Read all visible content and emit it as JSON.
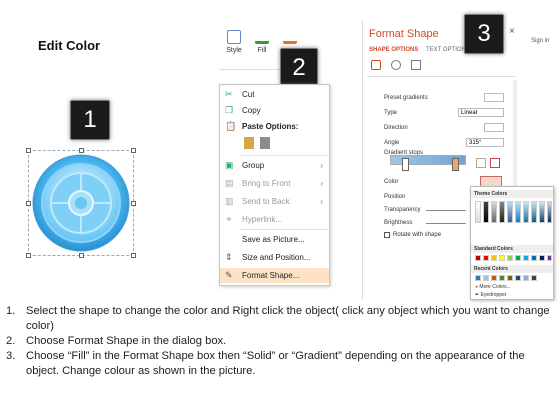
{
  "slide": {
    "title": "Edit Color"
  },
  "badges": [
    "1",
    "2",
    "3"
  ],
  "ribbon": {
    "style_label": "Style",
    "fill_label": "Fill"
  },
  "context_menu": {
    "items": [
      {
        "label": "Cut",
        "icon": "scissors-icon",
        "disabled": false
      },
      {
        "label": "Copy",
        "icon": "copy-icon",
        "disabled": false
      },
      {
        "label": "Paste Options:",
        "icon": "clipboard-icon",
        "disabled": false
      },
      {
        "label": "Group",
        "icon": "group-icon",
        "disabled": false,
        "submenu": true
      },
      {
        "label": "Bring to Front",
        "icon": "bring-to-front-icon",
        "disabled": true,
        "submenu": true
      },
      {
        "label": "Send to Back",
        "icon": "send-to-back-icon",
        "disabled": true,
        "submenu": true
      },
      {
        "label": "Hyperlink...",
        "icon": "hyperlink-icon",
        "disabled": true
      },
      {
        "label": "Save as Picture...",
        "icon": "",
        "disabled": false
      },
      {
        "label": "Size and Position...",
        "icon": "size-position-icon",
        "disabled": false
      },
      {
        "label": "Format Shape...",
        "icon": "format-shape-icon",
        "disabled": false,
        "highlighted": true
      }
    ]
  },
  "format_pane": {
    "title": "Format Shape",
    "tab_shape_options": "SHAPE OPTIONS",
    "tab_text_options": "TEXT OPTIONS",
    "sign_in": "Sign in",
    "rows": {
      "preset_gradients": "Preset gradients",
      "type": "Type",
      "type_value": "Linear",
      "direction": "Direction",
      "angle": "Angle",
      "angle_value": "315°",
      "gradient_stops": "Gradient stops",
      "color": "Color",
      "position": "Position",
      "transparency": "Transparency",
      "brightness": "Brightness",
      "rotate_with_shape": "Rotate with shape"
    },
    "palette": {
      "theme_colors": "Theme Colors",
      "standard_colors": "Standard Colors",
      "recent_colors": "Recent Colors",
      "more_colors": "More Colors...",
      "eyedropper": "Eyedropper"
    }
  },
  "instructions": [
    "Select the shape to change the color and Right click the object( click any object which you want to change color)",
    "Choose Format Shape in the dialog box.",
    "Choose “Fill” in the Format Shape box then “Solid” or “Gradient” depending on the appearance of the object. Change colour as shown in the picture."
  ]
}
